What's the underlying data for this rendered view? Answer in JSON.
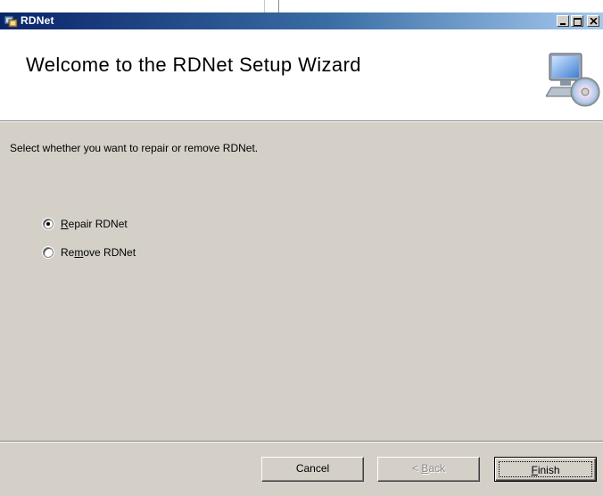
{
  "window": {
    "title": "RDNet",
    "controls": [
      "minimize-icon",
      "maximize-icon",
      "close-icon"
    ]
  },
  "banner": {
    "heading": "Welcome to the RDNet Setup Wizard",
    "icon": "computer-cd-icon"
  },
  "body": {
    "instruction": "Select whether you want to repair or remove RDNet.",
    "options": [
      {
        "label_pre": "",
        "label_key": "R",
        "label_post": "epair RDNet",
        "selected": true
      },
      {
        "label_pre": "Re",
        "label_key": "m",
        "label_post": "ove RDNet",
        "selected": false
      }
    ]
  },
  "buttons": {
    "cancel": "Cancel",
    "back_pre": "< ",
    "back_key": "B",
    "back_post": "ack",
    "finish_key": "F",
    "finish_post": "inish"
  },
  "colors": {
    "dialog_bg": "#d4d0c8",
    "title_start": "#0a246a",
    "title_end": "#a6caf0"
  }
}
